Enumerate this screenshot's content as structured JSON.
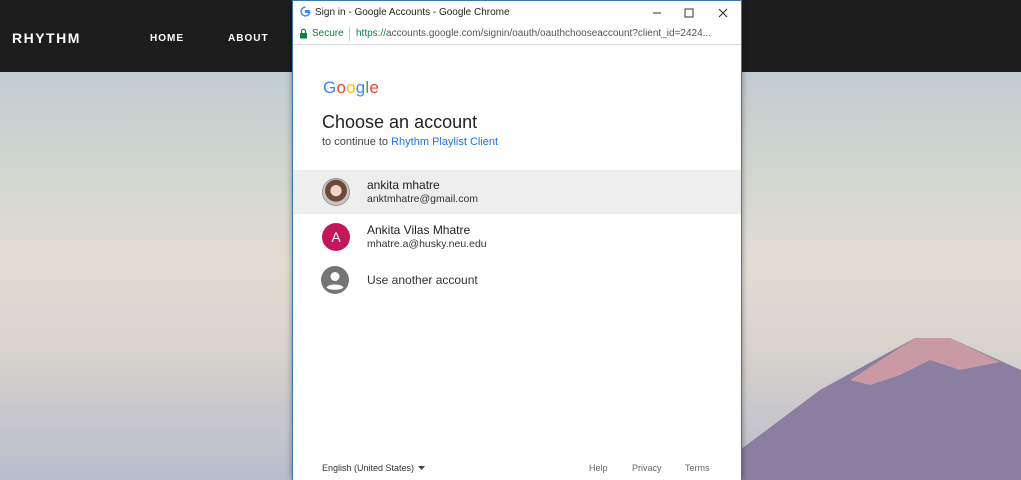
{
  "site": {
    "brand": "RHYTHM",
    "nav": [
      "HOME",
      "ABOUT"
    ]
  },
  "window": {
    "title": "Sign in - Google Accounts - Google Chrome",
    "secure_label": "Secure",
    "url_scheme": "https://",
    "url_rest": "accounts.google.com/signin/oauth/oauthchooseaccount?client_id=2424..."
  },
  "signin": {
    "logo_letters": [
      {
        "ch": "G",
        "color": "#4285F4"
      },
      {
        "ch": "o",
        "color": "#EA4335"
      },
      {
        "ch": "o",
        "color": "#FBBC05"
      },
      {
        "ch": "g",
        "color": "#4285F4"
      },
      {
        "ch": "l",
        "color": "#34A853"
      },
      {
        "ch": "e",
        "color": "#EA4335"
      }
    ],
    "heading": "Choose an account",
    "continue_prefix": "to continue to ",
    "app_name": "Rhythm Playlist Client",
    "accounts": [
      {
        "name": "ankita mhatre",
        "email": "anktmhatre@gmail.com"
      },
      {
        "name": "Ankita Vilas Mhatre",
        "email": "mhatre.a@husky.neu.edu",
        "initial": "A"
      }
    ],
    "another_account": "Use another account"
  },
  "footer": {
    "language": "English (United States)",
    "help": "Help",
    "privacy": "Privacy",
    "terms": "Terms"
  },
  "icons": {
    "favicon": "google-g-icon",
    "lock": "lock-icon",
    "person": "person-icon"
  }
}
